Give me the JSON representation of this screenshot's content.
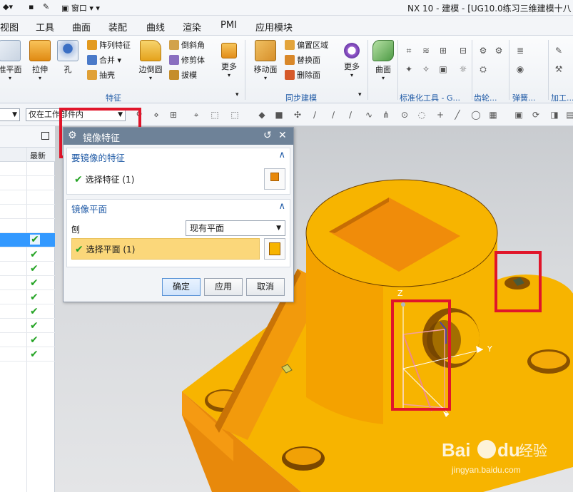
{
  "titlebar": {
    "window_menu": "窗口",
    "title": "NX 10 - 建模 - [UG10.0练习三维建模十八"
  },
  "menu": {
    "items": [
      "视图",
      "工具",
      "曲面",
      "装配",
      "曲线",
      "渲染",
      "PMI",
      "应用模块"
    ]
  },
  "ribbon": {
    "big_buttons": [
      "准平面",
      "拉伸",
      "孔",
      "边倒圆",
      "更多",
      "移动面",
      "更多",
      "曲面"
    ],
    "small_buttons": [
      "阵列特征",
      "合并",
      "抽壳",
      "倒斜角",
      "修剪体",
      "拔模",
      "偏置区域",
      "替换面",
      "删除面"
    ],
    "group_labels": [
      "特征",
      "同步建模",
      "标准化工具 - G...",
      "齿轮...",
      "弹簧...",
      "加工..."
    ]
  },
  "selection_bar": {
    "scope_value": "仅在工作部件内"
  },
  "navigator": {
    "column_latest": "最新",
    "check_rows": 9
  },
  "dialog": {
    "title": "镜像特征",
    "section1": {
      "title": "要镜像的特征",
      "select_label": "选择特征 (1)"
    },
    "section2": {
      "title": "镜像平面",
      "plane_label": "刨",
      "plane_option": "现有平面",
      "select_label": "选择平面 (1)"
    },
    "buttons": {
      "ok": "确定",
      "apply": "应用",
      "cancel": "取消"
    }
  },
  "viewport": {
    "axis_y": "Y",
    "axis_z": "Z"
  },
  "watermark": {
    "brand_bai": "Bai",
    "brand_du": "du",
    "brand_cn": "经验",
    "url": "jingyan.baidu.com"
  },
  "colors": {
    "part": "#f7b400",
    "part_shadow": "#e8890b",
    "highlight": "#e0152a",
    "dialog_title": "#6e8298"
  }
}
